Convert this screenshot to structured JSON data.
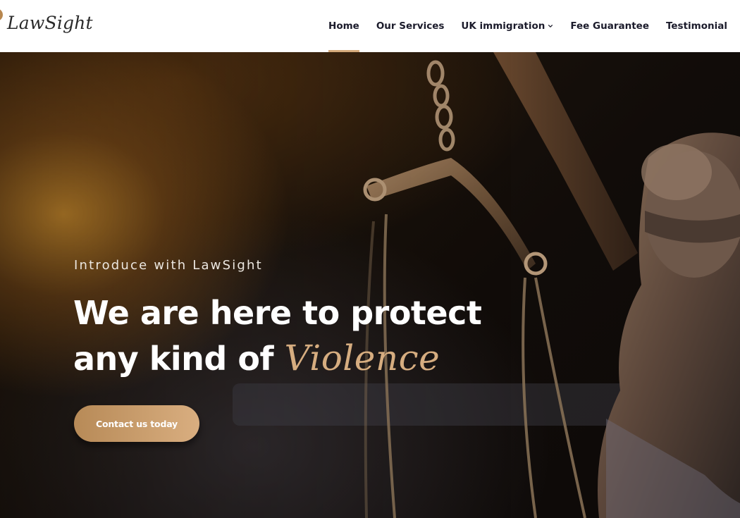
{
  "brand": {
    "name": "LawSight",
    "accent_color": "#b8874f"
  },
  "nav": {
    "items": [
      {
        "label": "Home",
        "active": true
      },
      {
        "label": "Our Services",
        "active": false
      },
      {
        "label": "UK immigration",
        "active": false,
        "has_dropdown": true,
        "icon": "chevron-down-icon"
      },
      {
        "label": "Fee Guarantee",
        "active": false
      },
      {
        "label": "Testimonial",
        "active": false
      }
    ],
    "active_underline_color": "#d4a97a"
  },
  "hero": {
    "eyebrow": "Introduce with LawSight",
    "headline_line1": "We are here to protect",
    "headline_line2_prefix": "any kind of ",
    "headline_line2_accent": "Violence",
    "accent_color": "#d6ad80",
    "cta_label": "Contact us today",
    "background_image": "scales-of-justice-statue"
  }
}
